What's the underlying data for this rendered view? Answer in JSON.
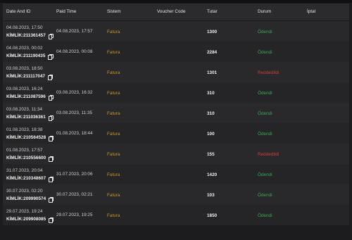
{
  "table": {
    "headers": {
      "date_and_id": "Date And ID",
      "paid_time": "Paid Time",
      "sistem": "Sistem",
      "voucher_code": "Voucher Code",
      "tutar": "Tutar",
      "durum": "Durum",
      "iptal": "İptal"
    },
    "rows": [
      {
        "date": "04.08.2023, 17:50",
        "kimlik": "KİMLİK:211361457",
        "paid_time": "04.08.2023, 17:57",
        "sistem": "Fatura",
        "voucher_code": "",
        "tutar": "1300",
        "durum": "Ödendi",
        "status": "paid"
      },
      {
        "date": "04.08.2023, 00:02",
        "kimlik": "KİMLİK:211190435",
        "paid_time": "04.08.2023, 00:08",
        "sistem": "Fatura",
        "voucher_code": "",
        "tutar": "2284",
        "durum": "Ödendi",
        "status": "paid"
      },
      {
        "date": "03.08.2023, 18:50",
        "kimlik": "KİMLİK:211117047",
        "paid_time": "",
        "sistem": "Fatura",
        "voucher_code": "",
        "tutar": "1301",
        "durum": "Reddedildi",
        "status": "rejected"
      },
      {
        "date": "03.08.2023, 16:24",
        "kimlik": "KİMLİK:211087596",
        "paid_time": "03.08.2023, 16:32",
        "sistem": "Fatura",
        "voucher_code": "",
        "tutar": "310",
        "durum": "Ödendi",
        "status": "paid"
      },
      {
        "date": "03.08.2023, 11:34",
        "kimlik": "KİMLİK:211036361",
        "paid_time": "03.08.2023, 11:35",
        "sistem": "Fatura",
        "voucher_code": "",
        "tutar": "310",
        "durum": "Ödendi",
        "status": "paid"
      },
      {
        "date": "01.08.2023, 18:38",
        "kimlik": "KİMLİK:210564528",
        "paid_time": "01.08.2023, 18:44",
        "sistem": "Fatura",
        "voucher_code": "",
        "tutar": "100",
        "durum": "Ödendi",
        "status": "paid"
      },
      {
        "date": "01.08.2023, 17:57",
        "kimlik": "KİMLİK:210556600",
        "paid_time": "",
        "sistem": "Fatura",
        "voucher_code": "",
        "tutar": "155",
        "durum": "Reddedildi",
        "status": "rejected"
      },
      {
        "date": "31.07.2023, 20:04",
        "kimlik": "KİMLİK:210348607",
        "paid_time": "31.07.2023, 20:06",
        "sistem": "Fatura",
        "voucher_code": "",
        "tutar": "1420",
        "durum": "Ödendi",
        "status": "paid"
      },
      {
        "date": "30.07.2023, 02:20",
        "kimlik": "KİMLİK:209990574",
        "paid_time": "30.07.2023, 02:21",
        "sistem": "Fatura",
        "voucher_code": "",
        "tutar": "103",
        "durum": "Ödendi",
        "status": "paid"
      },
      {
        "date": "29.07.2023, 19:24",
        "kimlik": "KİMLİK:209908085",
        "paid_time": "29.07.2023, 19:25",
        "sistem": "Fatura",
        "voucher_code": "",
        "tutar": "1850",
        "durum": "Ödendi",
        "status": "paid"
      }
    ]
  },
  "colors": {
    "background": "#1c1c1e",
    "panel": "#262628",
    "sistem_text": "#c6962e",
    "paid_status": "#3aa856",
    "rejected_status": "#d33c3c"
  },
  "icons": {
    "copy": "copy-icon"
  }
}
